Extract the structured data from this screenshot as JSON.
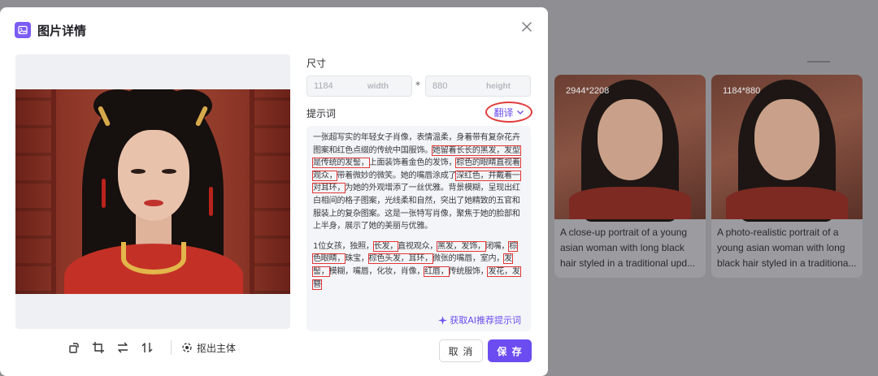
{
  "dialog": {
    "title": "图片详情",
    "colors": {
      "accent": "#6b4cf0",
      "highlight_outline": "#e13838"
    }
  },
  "size": {
    "label": "尺寸",
    "width_value": "1184",
    "width_unit": "width",
    "separator": "*",
    "height_value": "880",
    "height_unit": "height"
  },
  "prompt": {
    "label": "提示词",
    "translate_label": "翻译",
    "ai_suggest_label": "获取AI推荐提示词"
  },
  "toolbar": {
    "icons": [
      "rotate-icon",
      "crop-icon",
      "flip-horizontal-icon",
      "flip-vertical-icon"
    ],
    "extract_label": "抠出主体"
  },
  "actions": {
    "cancel_label": "取 消",
    "save_label": "保 存"
  },
  "background": {
    "cards": [
      {
        "size": "2944*2208",
        "caption": [
          "A close-up portrait of a young",
          "asian woman with long black",
          "hair styled in a traditional upd..."
        ]
      },
      {
        "size": "1184*880",
        "caption": [
          "A photo-realistic portrait of a",
          "young asian woman with long",
          "black hair styled in a traditiona..."
        ]
      }
    ]
  }
}
